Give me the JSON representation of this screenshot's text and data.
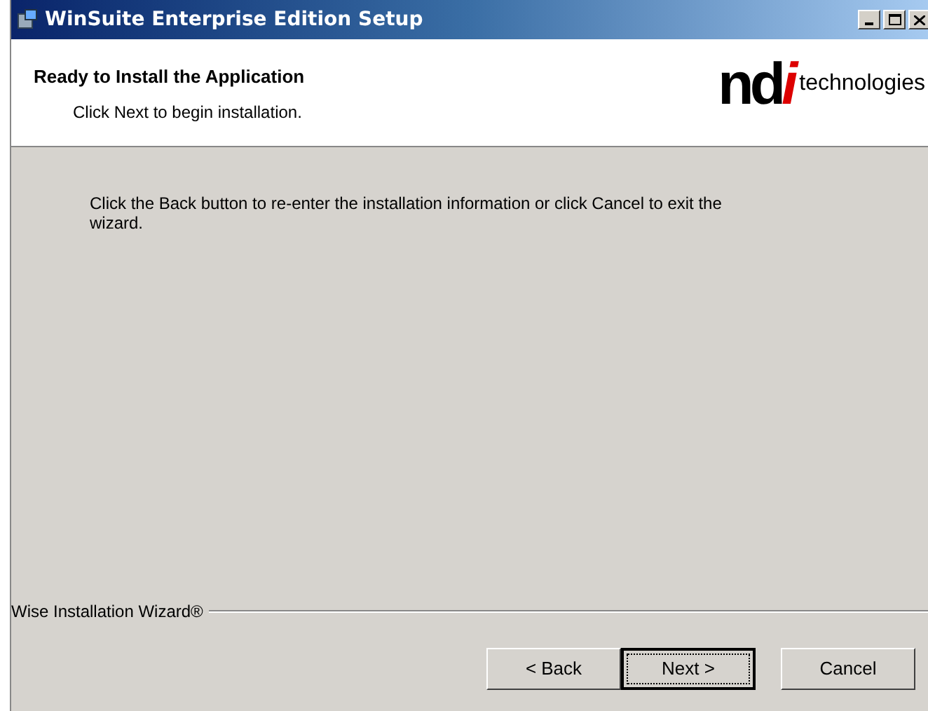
{
  "window": {
    "title": "WinSuite Enterprise Edition Setup"
  },
  "header": {
    "title": "Ready to Install the Application",
    "subtitle": "Click Next to begin installation.",
    "logo": {
      "mark_left": "nd",
      "mark_right": "i",
      "word": "technologies"
    }
  },
  "body": {
    "text": "Click the Back button to re-enter the installation information or click Cancel to exit the wizard."
  },
  "footer": {
    "brand": "Wise Installation Wizard®"
  },
  "buttons": [
    {
      "label": "< Back",
      "default": false
    },
    {
      "label": "Next >",
      "default": true
    },
    {
      "label": "Cancel",
      "default": false
    }
  ]
}
